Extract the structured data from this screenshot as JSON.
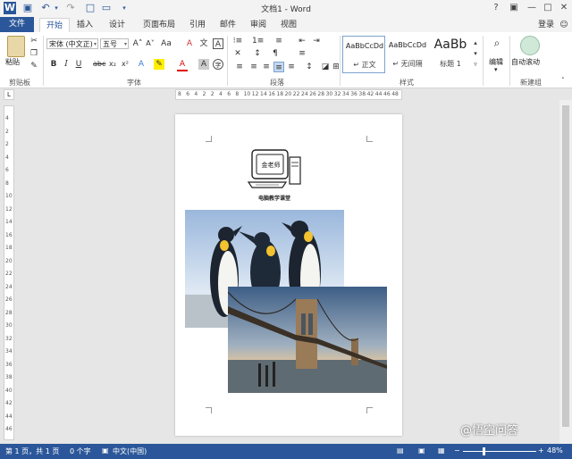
{
  "window": {
    "title": "文档1 - Word",
    "help": "?",
    "login": "登录"
  },
  "tabs": [
    "文件",
    "开始",
    "插入",
    "设计",
    "页面布局",
    "引用",
    "邮件",
    "审阅",
    "视图"
  ],
  "ribbon": {
    "clipboard": {
      "paste": "粘贴",
      "label": "剪贴板"
    },
    "font": {
      "name": "宋体 (中文正)",
      "size": "五号",
      "label": "字体"
    },
    "paragraph": {
      "label": "段落"
    },
    "styles": {
      "items": [
        {
          "sample": "AaBbCcDd",
          "name": "↵ 正文"
        },
        {
          "sample": "AaBbCcDd",
          "name": "↵ 无间隔"
        },
        {
          "sample": "AaBb",
          "name": "标题 1"
        }
      ],
      "label": "样式"
    },
    "editing": {
      "name": "编辑"
    },
    "new_group": {
      "autoscroll": "自动滚动",
      "label": "新建组"
    }
  },
  "ruler": {
    "h_ticks": [
      "8",
      "6",
      "4",
      "2",
      "2",
      "4",
      "6",
      "8",
      "10",
      "12",
      "14",
      "16",
      "18",
      "20",
      "22",
      "24",
      "26",
      "28",
      "30",
      "32",
      "34",
      "36",
      "38",
      "42",
      "44",
      "46",
      "48"
    ],
    "v_ticks": [
      "4",
      "2",
      "2",
      "4",
      "6",
      "8",
      "10",
      "12",
      "14",
      "16",
      "18",
      "20",
      "22",
      "24",
      "26",
      "28",
      "30",
      "32",
      "34",
      "36",
      "38",
      "40",
      "42",
      "44",
      "46"
    ]
  },
  "document": {
    "logo_text": "金老师",
    "caption": "电脑教学课堂"
  },
  "status": {
    "page": "第 1 页，共 1 页",
    "words": "0 个字",
    "lang": "中文(中国)",
    "zoom": "48%",
    "watermark": "@悟空问答"
  },
  "colors": {
    "accent": "#2b579a"
  }
}
